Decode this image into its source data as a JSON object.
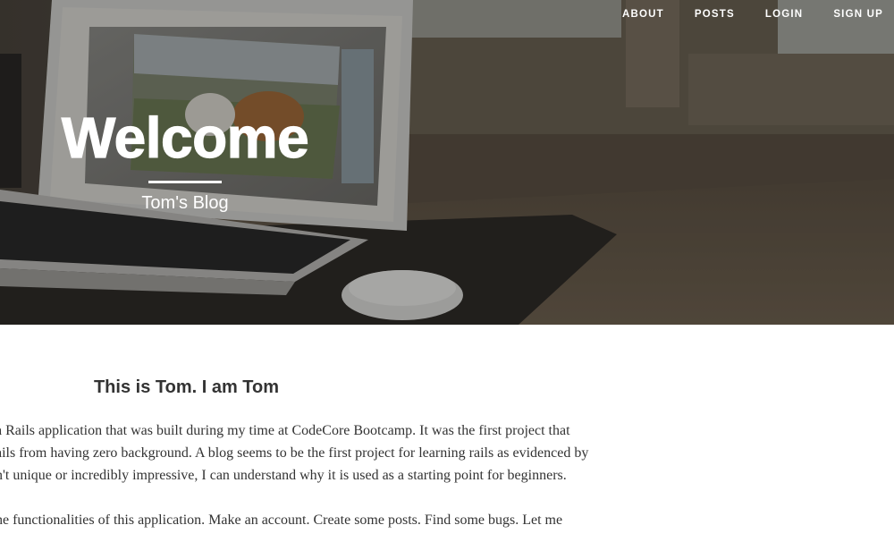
{
  "nav": {
    "items": [
      {
        "label": "ABOUT"
      },
      {
        "label": "POSTS"
      },
      {
        "label": "LOGIN"
      },
      {
        "label": "SIGN UP"
      }
    ]
  },
  "hero": {
    "title": "Welcome",
    "subtitle": "Tom's Blog",
    "background_icon": "laptop-desk-photo"
  },
  "post": {
    "heading": "This is Tom. I am Tom",
    "paragraph1": [
      "a Rails application that was built during my time at CodeCore Bootcamp. It was the first project that",
      "ails from having zero background. A blog seems to be the first project for learning rails as evidenced by",
      "n't unique or incredibly impressive, I can understand why it is used as a starting point for beginners."
    ],
    "paragraph2": [
      "he functionalities of this application. Make an account. Create some posts. Find some bugs. Let me"
    ]
  },
  "colors": {
    "text": "#333333",
    "hero_overlay": "#3a352f",
    "white": "#ffffff"
  }
}
